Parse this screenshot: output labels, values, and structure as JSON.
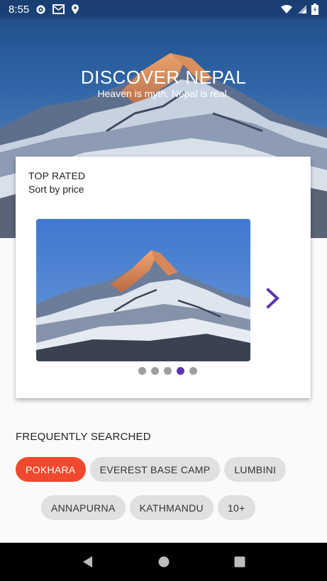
{
  "status_bar": {
    "time": "8:55",
    "icons": [
      "gear-icon",
      "mail-icon",
      "location-icon",
      "wifi-icon",
      "signal-icon",
      "battery-icon"
    ]
  },
  "hero": {
    "title": "DISCOVER NEPAL",
    "subtitle": "Heaven is myth. Nepal is real."
  },
  "top_rated": {
    "heading": "TOP RATED",
    "sort_label": "Sort by price",
    "carousel": {
      "page_count": 5,
      "active_index": 3,
      "next_icon": "chevron-right-icon"
    }
  },
  "frequently_searched": {
    "title": "FREQUENTLY SEARCHED",
    "chips_row1": [
      "POKHARA",
      "EVEREST BASE CAMP",
      "LUMBINI"
    ],
    "chips_row2": [
      "ANNAPURNA",
      "KATHMANDU",
      "10+"
    ],
    "selected": "POKHARA"
  },
  "nav_bar": {
    "buttons": [
      "back-icon",
      "home-icon",
      "recents-icon"
    ]
  },
  "colors": {
    "accent": "#5e35b1",
    "chip_selected": "#f0492f",
    "chip_default": "#e0e0e0",
    "navbar": "#000000"
  }
}
